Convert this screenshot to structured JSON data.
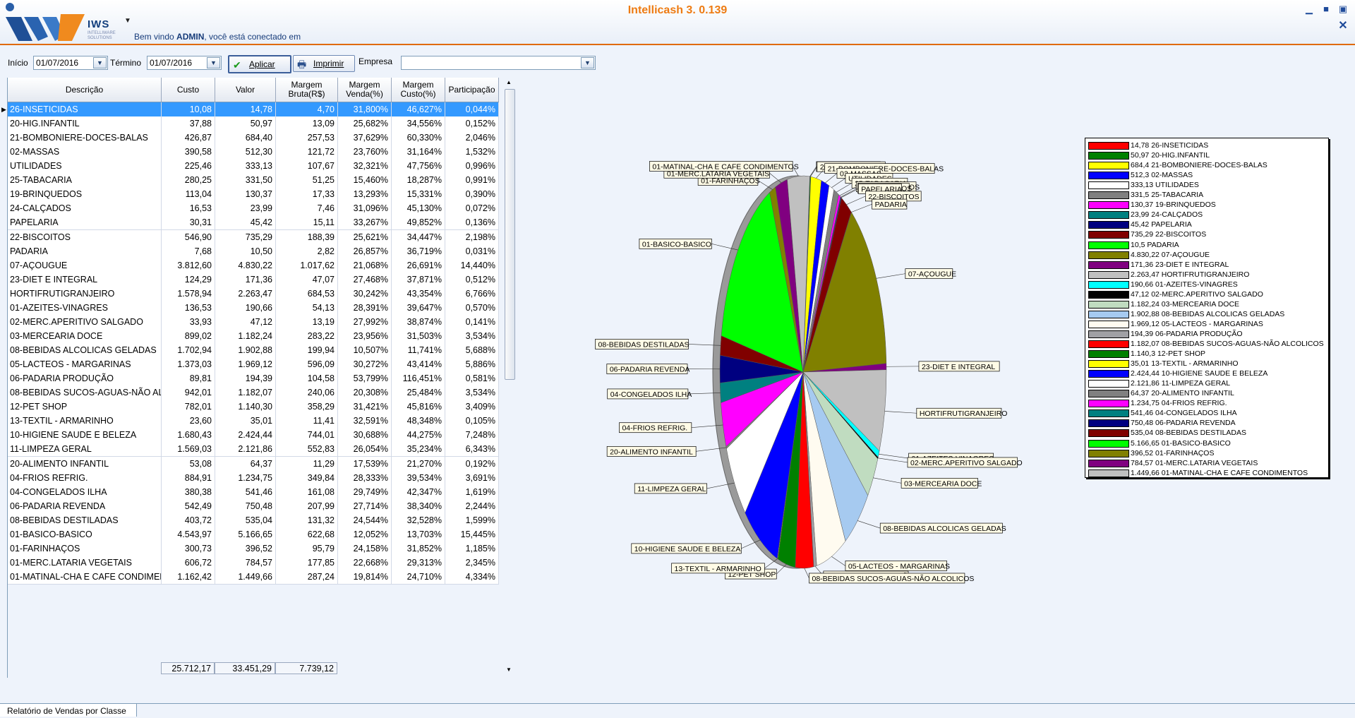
{
  "app": {
    "title": "Intellicash 3. 0.139",
    "logo_word": "IWS",
    "logo_sub": "INTELLIWARE SOLUTIONS",
    "welcome_prefix": "Bem vindo ",
    "welcome_user": "ADMIN",
    "welcome_suffix": ", você está conectado em"
  },
  "filters": {
    "inicio_label": "Início",
    "inicio_value": "01/07/2016",
    "termino_label": "Término",
    "termino_value": "01/07/2016",
    "aplicar_label": "Aplicar",
    "imprimir_label": "Imprimir",
    "empresa_label": "Empresa",
    "empresa_value": ""
  },
  "table": {
    "headers": [
      "Descrição",
      "Custo",
      "Valor",
      "Margem\nBruta(R$)",
      "Margem\nVenda(%)",
      "Margem\nCusto(%)",
      "Participação"
    ],
    "rows": [
      [
        "26-INSETICIDAS",
        "10,08",
        "14,78",
        "4,70",
        "31,800%",
        "46,627%",
        "0,044%"
      ],
      [
        "20-HIG.INFANTIL",
        "37,88",
        "50,97",
        "13,09",
        "25,682%",
        "34,556%",
        "0,152%"
      ],
      [
        "21-BOMBONIERE-DOCES-BALAS",
        "426,87",
        "684,40",
        "257,53",
        "37,629%",
        "60,330%",
        "2,046%"
      ],
      [
        "02-MASSAS",
        "390,58",
        "512,30",
        "121,72",
        "23,760%",
        "31,164%",
        "1,532%"
      ],
      [
        "UTILIDADES",
        "225,46",
        "333,13",
        "107,67",
        "32,321%",
        "47,756%",
        "0,996%"
      ],
      [
        "25-TABACARIA",
        "280,25",
        "331,50",
        "51,25",
        "15,460%",
        "18,287%",
        "0,991%"
      ],
      [
        "19-BRINQUEDOS",
        "113,04",
        "130,37",
        "17,33",
        "13,293%",
        "15,331%",
        "0,390%"
      ],
      [
        "24-CALÇADOS",
        "16,53",
        "23,99",
        "7,46",
        "31,096%",
        "45,130%",
        "0,072%"
      ],
      [
        "PAPELARIA",
        "30,31",
        "45,42",
        "15,11",
        "33,267%",
        "49,852%",
        "0,136%"
      ],
      [
        "22-BISCOITOS",
        "546,90",
        "735,29",
        "188,39",
        "25,621%",
        "34,447%",
        "2,198%"
      ],
      [
        "PADARIA",
        "7,68",
        "10,50",
        "2,82",
        "26,857%",
        "36,719%",
        "0,031%"
      ],
      [
        "07-AÇOUGUE",
        "3.812,60",
        "4.830,22",
        "1.017,62",
        "21,068%",
        "26,691%",
        "14,440%"
      ],
      [
        "23-DIET E INTEGRAL",
        "124,29",
        "171,36",
        "47,07",
        "27,468%",
        "37,871%",
        "0,512%"
      ],
      [
        "HORTIFRUTIGRANJEIRO",
        "1.578,94",
        "2.263,47",
        "684,53",
        "30,242%",
        "43,354%",
        "6,766%"
      ],
      [
        "01-AZEITES-VINAGRES",
        "136,53",
        "190,66",
        "54,13",
        "28,391%",
        "39,647%",
        "0,570%"
      ],
      [
        "02-MERC.APERITIVO SALGADO",
        "33,93",
        "47,12",
        "13,19",
        "27,992%",
        "38,874%",
        "0,141%"
      ],
      [
        "03-MERCEARIA DOCE",
        "899,02",
        "1.182,24",
        "283,22",
        "23,956%",
        "31,503%",
        "3,534%"
      ],
      [
        "08-BEBIDAS ALCOLICAS GELADAS",
        "1.702,94",
        "1.902,88",
        "199,94",
        "10,507%",
        "11,741%",
        "5,688%"
      ],
      [
        "05-LACTEOS - MARGARINAS",
        "1.373,03",
        "1.969,12",
        "596,09",
        "30,272%",
        "43,414%",
        "5,886%"
      ],
      [
        "06-PADARIA PRODUÇÃO",
        "89,81",
        "194,39",
        "104,58",
        "53,799%",
        "116,451%",
        "0,581%"
      ],
      [
        "08-BEBIDAS SUCOS-AGUAS-NÃO ALCOLICOS",
        "942,01",
        "1.182,07",
        "240,06",
        "20,308%",
        "25,484%",
        "3,534%"
      ],
      [
        "12-PET SHOP",
        "782,01",
        "1.140,30",
        "358,29",
        "31,421%",
        "45,816%",
        "3,409%"
      ],
      [
        "13-TEXTIL - ARMARINHO",
        "23,60",
        "35,01",
        "11,41",
        "32,591%",
        "48,348%",
        "0,105%"
      ],
      [
        "10-HIGIENE SAUDE E BELEZA",
        "1.680,43",
        "2.424,44",
        "744,01",
        "30,688%",
        "44,275%",
        "7,248%"
      ],
      [
        "11-LIMPEZA GERAL",
        "1.569,03",
        "2.121,86",
        "552,83",
        "26,054%",
        "35,234%",
        "6,343%"
      ],
      [
        "20-ALIMENTO INFANTIL",
        "53,08",
        "64,37",
        "11,29",
        "17,539%",
        "21,270%",
        "0,192%"
      ],
      [
        "04-FRIOS REFRIG.",
        "884,91",
        "1.234,75",
        "349,84",
        "28,333%",
        "39,534%",
        "3,691%"
      ],
      [
        "04-CONGELADOS ILHA",
        "380,38",
        "541,46",
        "161,08",
        "29,749%",
        "42,347%",
        "1,619%"
      ],
      [
        "06-PADARIA REVENDA",
        "542,49",
        "750,48",
        "207,99",
        "27,714%",
        "38,340%",
        "2,244%"
      ],
      [
        "08-BEBIDAS DESTILADAS",
        "403,72",
        "535,04",
        "131,32",
        "24,544%",
        "32,528%",
        "1,599%"
      ],
      [
        "01-BASICO-BASICO",
        "4.543,97",
        "5.166,65",
        "622,68",
        "12,052%",
        "13,703%",
        "15,445%"
      ],
      [
        "01-FARINHAÇOS",
        "300,73",
        "396,52",
        "95,79",
        "24,158%",
        "31,852%",
        "1,185%"
      ],
      [
        "01-MERC.LATARIA VEGETAIS",
        "606,72",
        "784,57",
        "177,85",
        "22,668%",
        "29,313%",
        "2,345%"
      ],
      [
        "01-MATINAL-CHA E CAFE CONDIMENTOS",
        "1.162,42",
        "1.449,66",
        "287,24",
        "19,814%",
        "24,710%",
        "4,334%"
      ]
    ],
    "totals": {
      "custo": "25.712,17",
      "valor": "33.451,29",
      "margem": "7.739,12"
    }
  },
  "chart_data": {
    "type": "pie",
    "values": [
      14.78,
      50.97,
      684.4,
      512.3,
      333.13,
      331.5,
      130.37,
      23.99,
      45.42,
      735.29,
      10.5,
      4830.22,
      171.36,
      2263.47,
      190.66,
      47.12,
      1182.24,
      1902.88,
      1969.12,
      194.39,
      1182.07,
      1140.3,
      35.01,
      2424.44,
      2121.86,
      64.37,
      1234.75,
      541.46,
      750.48,
      535.04,
      5166.65,
      396.52,
      784.57,
      1449.66
    ],
    "colors": [
      "#ff0000",
      "#008000",
      "#ffff00",
      "#0000ff",
      "#ffffff",
      "#808080",
      "#ff00ff",
      "#008080",
      "#000080",
      "#800000",
      "#00ff00",
      "#808000",
      "#800080",
      "#c0c0c0",
      "#00ffff",
      "#000000",
      "#c0dcc0",
      "#a6caf0",
      "#fffbf0",
      "#a0a0a4",
      "#ff0000",
      "#008000",
      "#ffff00",
      "#0000ff",
      "#ffffff",
      "#808080",
      "#ff00ff",
      "#008080",
      "#000080",
      "#800000",
      "#00ff00",
      "#808000",
      "#800080",
      "#c0c0c0"
    ],
    "legend": [
      "14,78 26-INSETICIDAS",
      "50,97 20-HIG.INFANTIL",
      "684,4 21-BOMBONIERE-DOCES-BALAS",
      "512,3 02-MASSAS",
      "333,13 UTILIDADES",
      "331,5 25-TABACARIA",
      "130,37 19-BRINQUEDOS",
      "23,99 24-CALÇADOS",
      "45,42 PAPELARIA",
      "735,29 22-BISCOITOS",
      "10,5 PADARIA",
      "4.830,22 07-AÇOUGUE",
      "171,36 23-DIET E INTEGRAL",
      "2.263,47 HORTIFRUTIGRANJEIRO",
      "190,66 01-AZEITES-VINAGRES",
      "47,12 02-MERC.APERITIVO SALGADO",
      "1.182,24 03-MERCEARIA DOCE",
      "1.902,88 08-BEBIDAS ALCOLICAS GELADAS",
      "1.969,12 05-LACTEOS - MARGARINAS",
      "194,39 06-PADARIA PRODUÇÃO",
      "1.182,07 08-BEBIDAS SUCOS-AGUAS-NÃO ALCOLICOS",
      "1.140,3 12-PET SHOP",
      "35,01 13-TEXTIL - ARMARINHO",
      "2.424,44 10-HIGIENE SAUDE E BELEZA",
      "2.121,86 11-LIMPEZA GERAL",
      "64,37 20-ALIMENTO INFANTIL",
      "1.234,75 04-FRIOS REFRIG.",
      "541,46 04-CONGELADOS ILHA",
      "750,48 06-PADARIA REVENDA",
      "535,04 08-BEBIDAS DESTILADAS",
      "5.166,65 01-BASICO-BASICO",
      "396,52 01-FARINHAÇOS",
      "784,57 01-MERC.LATARIA VEGETAIS",
      "1.449,66 01-MATINAL-CHA E CAFE CONDIMENTOS"
    ],
    "slice_labels": [
      "26-INSETICIDAS",
      "20-HIG.INFANTIL",
      "21-BOMBONIERE-DOCES-BALAS",
      "02-MASSAS",
      "UTILIDADES",
      "25-TABACARIA",
      "19-BRINQUEDOS",
      "24-CALÇADOS",
      "PAPELARIA",
      "22-BISCOITOS",
      "PADARIA",
      "07-AÇOUGUE",
      "23-DIET E INTEGRAL",
      "HORTIFRUTIGRANJEIRO",
      "01-AZEITES-VINAGRES",
      "02-MERC.APERITIVO SALGADO",
      "03-MERCEARIA DOCE",
      "08-BEBIDAS ALCOLICAS GELADAS",
      "05-LACTEOS - MARGARINAS",
      "06-PADARIA PRODUÇÃO",
      "08-BEBIDAS SUCOS-AGUAS-NÃO ALCOLICOS",
      "12-PET SHOP",
      "13-TEXTIL - ARMARINHO",
      "10-HIGIENE SAUDE E BELEZA",
      "11-LIMPEZA GERAL",
      "20-ALIMENTO INFANTIL",
      "04-FRIOS REFRIG.",
      "04-CONGELADOS ILHA",
      "06-PADARIA REVENDA",
      "08-BEBIDAS DESTILADAS",
      "01-BASICO-BASICO",
      "01-FARINHAÇOS",
      "01-MERC.LATARIA VEGETAIS",
      "01-MATINAL-CHA E CAFE CONDIMENTOS"
    ]
  },
  "footer": {
    "tab_label": "Relatório de Vendas por Classe"
  }
}
